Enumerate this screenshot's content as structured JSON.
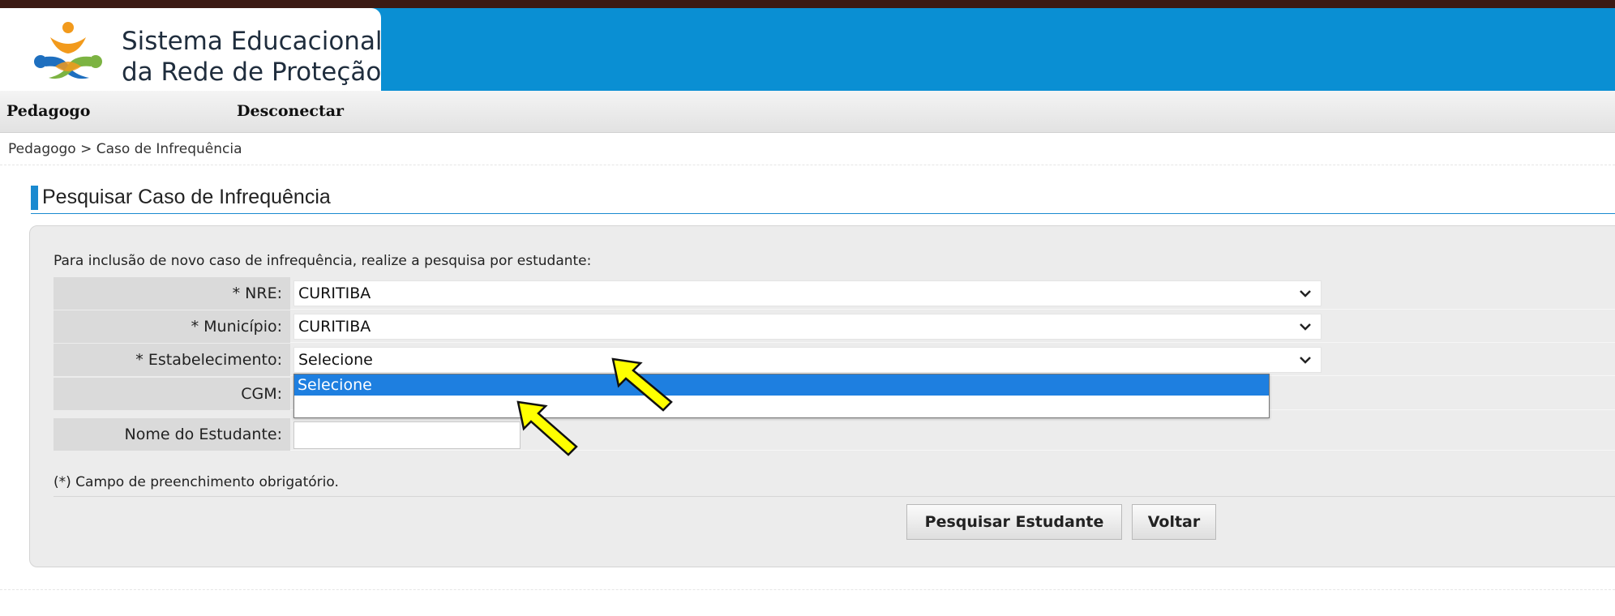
{
  "header": {
    "logo_line1": "Sistema Educacional",
    "logo_line2": "da Rede de Proteção",
    "bar_color": "#0a8fd3",
    "top_strip_color": "#3b1a14"
  },
  "menu": {
    "items": [
      {
        "label": "Pedagogo"
      },
      {
        "label": "Desconectar"
      }
    ]
  },
  "breadcrumb": "Pedagogo > Caso de Infrequência",
  "page": {
    "title": "Pesquisar Caso de Infrequência",
    "accent_color": "#1a8ad0"
  },
  "form": {
    "intro": "Para inclusão de novo caso de infrequência, realize a pesquisa por estudante:",
    "nre": {
      "label": "* NRE:",
      "value": "CURITIBA"
    },
    "municipio": {
      "label": "* Município:",
      "value": "CURITIBA"
    },
    "estabelecimento": {
      "label": "* Estabelecimento:",
      "value": "Selecione"
    },
    "cgm": {
      "label": "CGM:",
      "value": ""
    },
    "nome": {
      "label": "Nome do Estudante:",
      "value": ""
    },
    "dropdown_options": [
      "Selecione",
      ""
    ],
    "dropdown_selected_color": "#1e7fe0",
    "required_note": "(*) Campo de preenchimento obrigatório.",
    "search_button": "Pesquisar Estudante",
    "back_button": "Voltar"
  },
  "annotations": {
    "arrow_color": "#ffff00",
    "arrow_icon": "yellow-arrow-icon"
  }
}
